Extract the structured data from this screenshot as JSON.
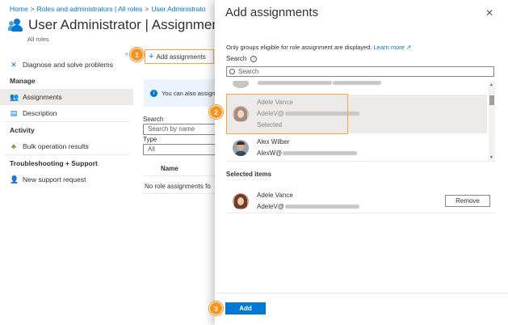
{
  "breadcrumb": [
    "Home",
    "Roles and administrators | All roles",
    "User Administrato"
  ],
  "page": {
    "title": "User Administrator | Assignments",
    "subtitle": "All roles",
    "add_assignments_label": "Add assignments",
    "info_text": "You can also assign",
    "filter": {
      "search_label": "Search",
      "search_placeholder": "Search by name",
      "type_label": "Type",
      "type_value": "All"
    },
    "table": {
      "name_header": "Name",
      "empty_text": "No role assignments fo"
    }
  },
  "left_nav": {
    "diagnose": "Diagnose and solve problems",
    "manage_section": "Manage",
    "assignments": "Assignments",
    "description": "Description",
    "activity_section": "Activity",
    "bulk_results": "Bulk operation results",
    "troubleshoot_section": "Troubleshooting + Support",
    "new_support": "New support request"
  },
  "steps": [
    "1",
    "2",
    "3"
  ],
  "panel": {
    "title": "Add assignments",
    "note": "Only groups eligible for role assignment are displayed.",
    "learn_more": "Learn more",
    "search_label": "Search",
    "search_placeholder": "Search",
    "results": [
      {
        "name": "Adele Vance",
        "email": "AdeleV@",
        "status": "Selected"
      },
      {
        "name": "Alex Wilber",
        "email": "AlexW@"
      }
    ],
    "selected_title": "Selected items",
    "selected": {
      "name": "Adele Vance",
      "email": "AdeleV@"
    },
    "remove_label": "Remove",
    "add_label": "Add"
  },
  "colors": {
    "accent": "#0078d4",
    "step": "#f7931e",
    "highlight": "#f7a54a"
  }
}
